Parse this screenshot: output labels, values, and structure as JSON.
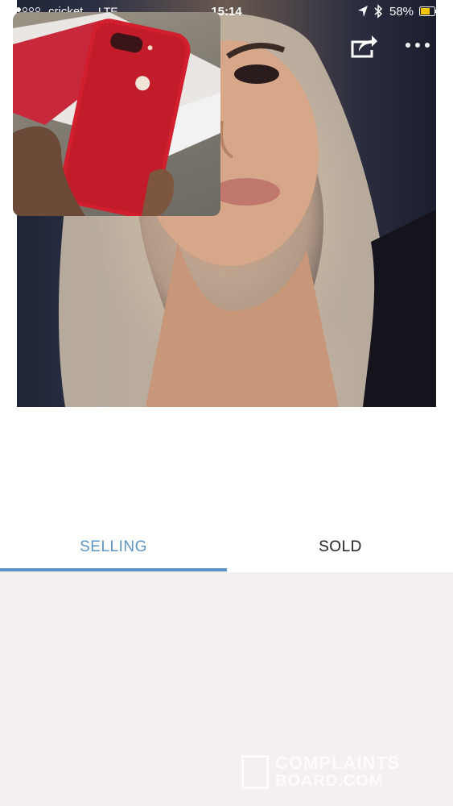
{
  "status_bar": {
    "carrier": "cricket",
    "network": "LTE",
    "time": "15:14",
    "battery": "58%",
    "icons": [
      "signal-dots",
      "location-arrow-icon",
      "bluetooth-icon",
      "battery-icon"
    ]
  },
  "header": {
    "icons": [
      "back-arrow-icon",
      "share-icon",
      "more-options-icon"
    ]
  },
  "tabs": [
    {
      "label": "SELLING",
      "selected": true
    },
    {
      "label": "SOLD",
      "selected": false
    }
  ],
  "colors": {
    "accent": "#5d93c6",
    "grid_background": "#f4f0ef",
    "battery": "#f5c400"
  },
  "watermark": {
    "line1": "COMPLAINTS",
    "line2": "BOARD.COM"
  }
}
